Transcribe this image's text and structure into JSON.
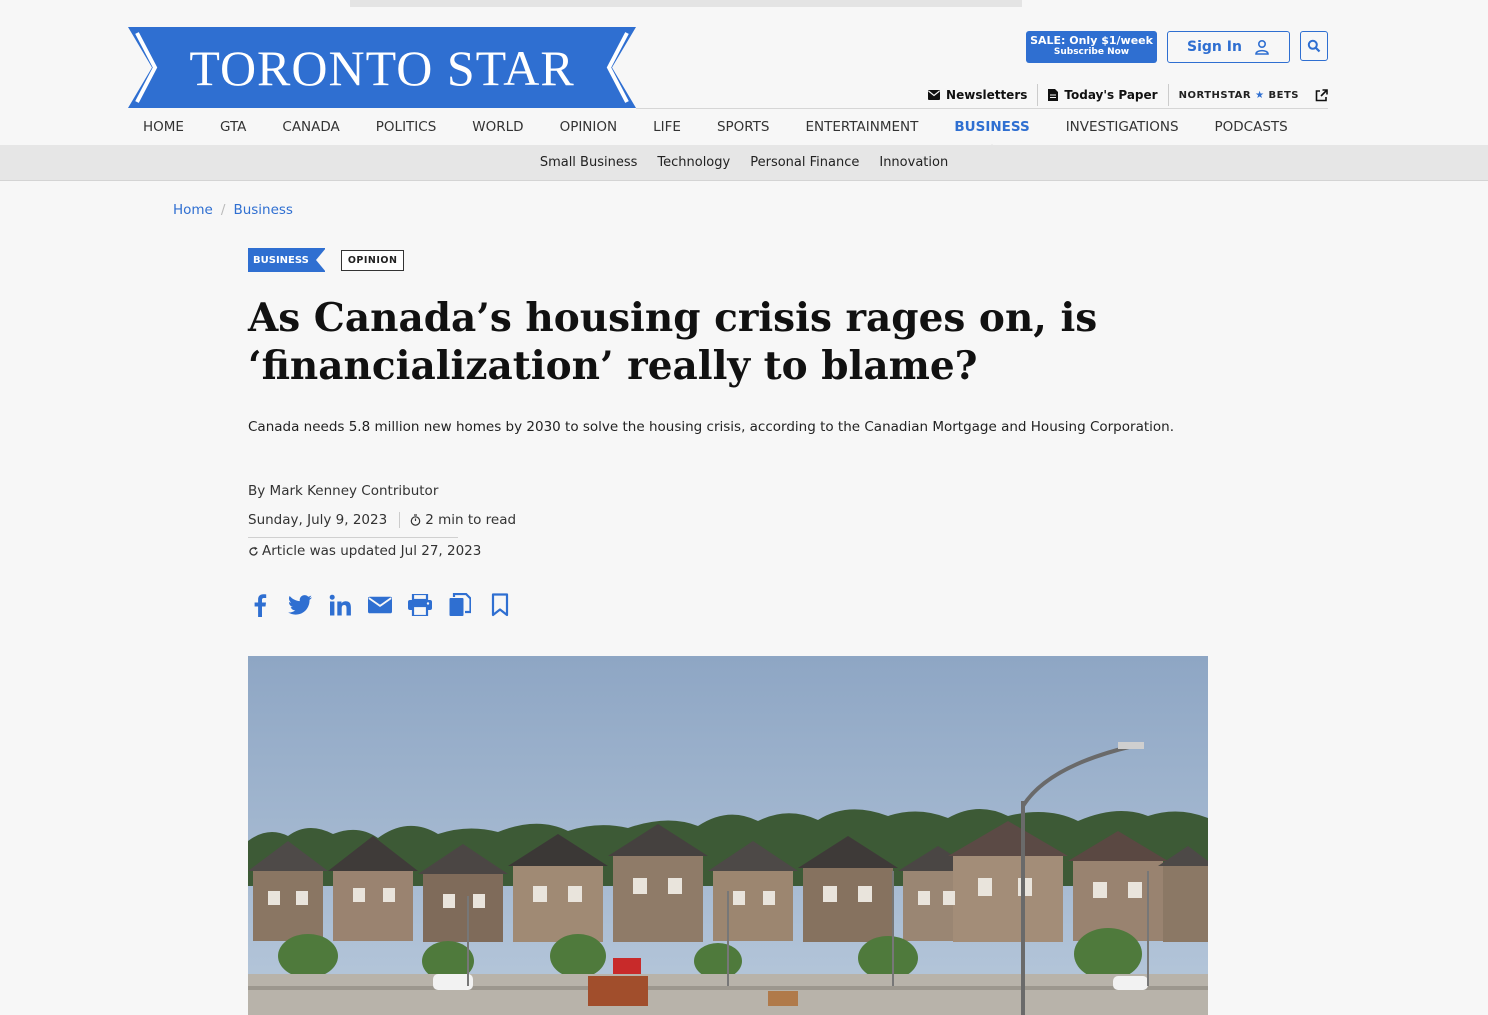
{
  "brand": {
    "logo_text": "TORONTO STAR",
    "accent": "#2f6fd1"
  },
  "header": {
    "sale_line1": "SALE: Only $1/week",
    "sale_line2": "Subscribe Now",
    "sign_in": "Sign In",
    "utility": {
      "newsletters": "Newsletters",
      "todays_paper": "Today's Paper",
      "northstar_left": "NORTHSTAR",
      "northstar_right": "BETS"
    }
  },
  "nav": {
    "items": [
      "HOME",
      "GTA",
      "CANADA",
      "POLITICS",
      "WORLD",
      "OPINION",
      "LIFE",
      "SPORTS",
      "ENTERTAINMENT",
      "BUSINESS",
      "INVESTIGATIONS",
      "PODCASTS"
    ],
    "active": "BUSINESS",
    "sub": [
      "Small Business",
      "Technology",
      "Personal Finance",
      "Innovation"
    ]
  },
  "breadcrumb": {
    "home": "Home",
    "sep": "/",
    "section": "Business"
  },
  "article": {
    "tag_section": "BUSINESS",
    "tag_type": "OPINION",
    "headline": "As Canada’s housing crisis rages on, is ‘financialization’ really to blame?",
    "dek": "Canada needs 5.8 million new homes by 2030 to solve the housing crisis, according to the Canadian Mortgage and Housing Corporation.",
    "byline": "By Mark Kenney Contributor",
    "date": "Sunday, July 9, 2023",
    "read_time": "2 min to read",
    "updated": "Article was updated Jul 27, 2023"
  },
  "share_icons": [
    "facebook-icon",
    "twitter-icon",
    "linkedin-icon",
    "email-icon",
    "print-icon",
    "copy-icon",
    "bookmark-icon"
  ]
}
